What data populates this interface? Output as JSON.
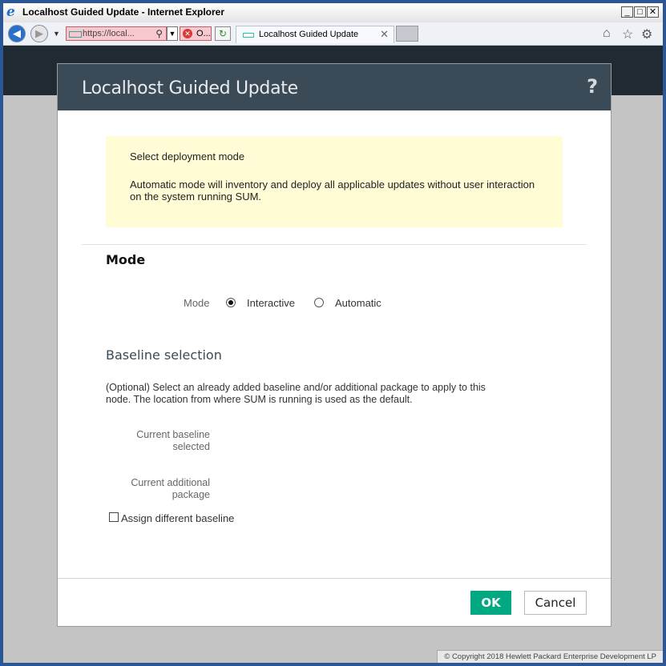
{
  "window": {
    "title": "Localhost Guided Update - Internet Explorer"
  },
  "browser": {
    "address": "https://local...",
    "cert_label": "O...",
    "tab_title": "Localhost Guided Update"
  },
  "modal": {
    "title": "Localhost Guided Update",
    "help": "?",
    "note": {
      "heading": "Select deployment mode",
      "body": "Automatic mode will inventory and deploy all applicable updates without user interaction on the system running SUM."
    },
    "mode_section": {
      "title": "Mode",
      "label": "Mode",
      "options": [
        "Interactive",
        "Automatic"
      ],
      "selected": "Interactive"
    },
    "baseline_section": {
      "title": "Baseline selection",
      "description": "(Optional) Select an already added baseline and/or additional package to apply to this node. The location from where SUM is running is used as the default.",
      "current_baseline_label": "Current baseline selected",
      "current_package_label": "Current additional package",
      "assign_checkbox_label": "Assign different baseline",
      "assign_checked": false
    },
    "buttons": {
      "ok": "OK",
      "cancel": "Cancel"
    }
  },
  "footer": {
    "copyright": "© Copyright 2018 Hewlett Packard Enterprise Development LP"
  },
  "colors": {
    "accent": "#01a982",
    "header": "#3b4a57",
    "note_bg": "#fffcd6"
  }
}
